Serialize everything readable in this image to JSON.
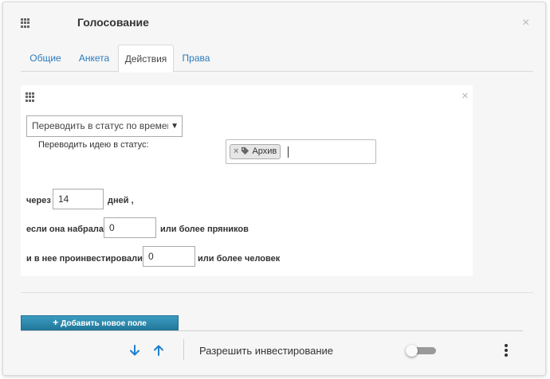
{
  "dialog": {
    "title": "Голосование",
    "close_glyph": "×"
  },
  "tabs": [
    {
      "label": "Общие",
      "active": false
    },
    {
      "label": "Анкета",
      "active": false
    },
    {
      "label": "Действия",
      "active": true
    },
    {
      "label": "Права",
      "active": false
    }
  ],
  "action_panel": {
    "close_glyph": "×",
    "action_select": {
      "value": "Переводить в статус по времени",
      "arrow": "▼"
    },
    "status_label": "Переводить идею в статус:",
    "status_tag": {
      "label": "Архив",
      "remove_glyph": "×",
      "icon": "tag-icon"
    },
    "days_row": {
      "prefix": "через",
      "value": "14",
      "suffix": "дней ,"
    },
    "gingerbread_row": {
      "prefix": "если она набрала",
      "value": "0",
      "suffix": "или более пряников"
    },
    "investors_row": {
      "prefix": "и в нее проинвестировали",
      "value": "0",
      "suffix": "или более человек"
    }
  },
  "add_field_button": {
    "plus": "+",
    "label": "Добавить новое поле"
  },
  "footer": {
    "move_down_icon": "arrow-down-icon",
    "move_up_icon": "arrow-up-icon",
    "allow_investing_label": "Разрешить инвестирование",
    "allow_investing_enabled": false,
    "more_icon": "kebab-menu-icon"
  },
  "colors": {
    "accent_link": "#2a7bbf",
    "button": "#2a86ab",
    "arrow_icon": "#1e7fd0"
  }
}
